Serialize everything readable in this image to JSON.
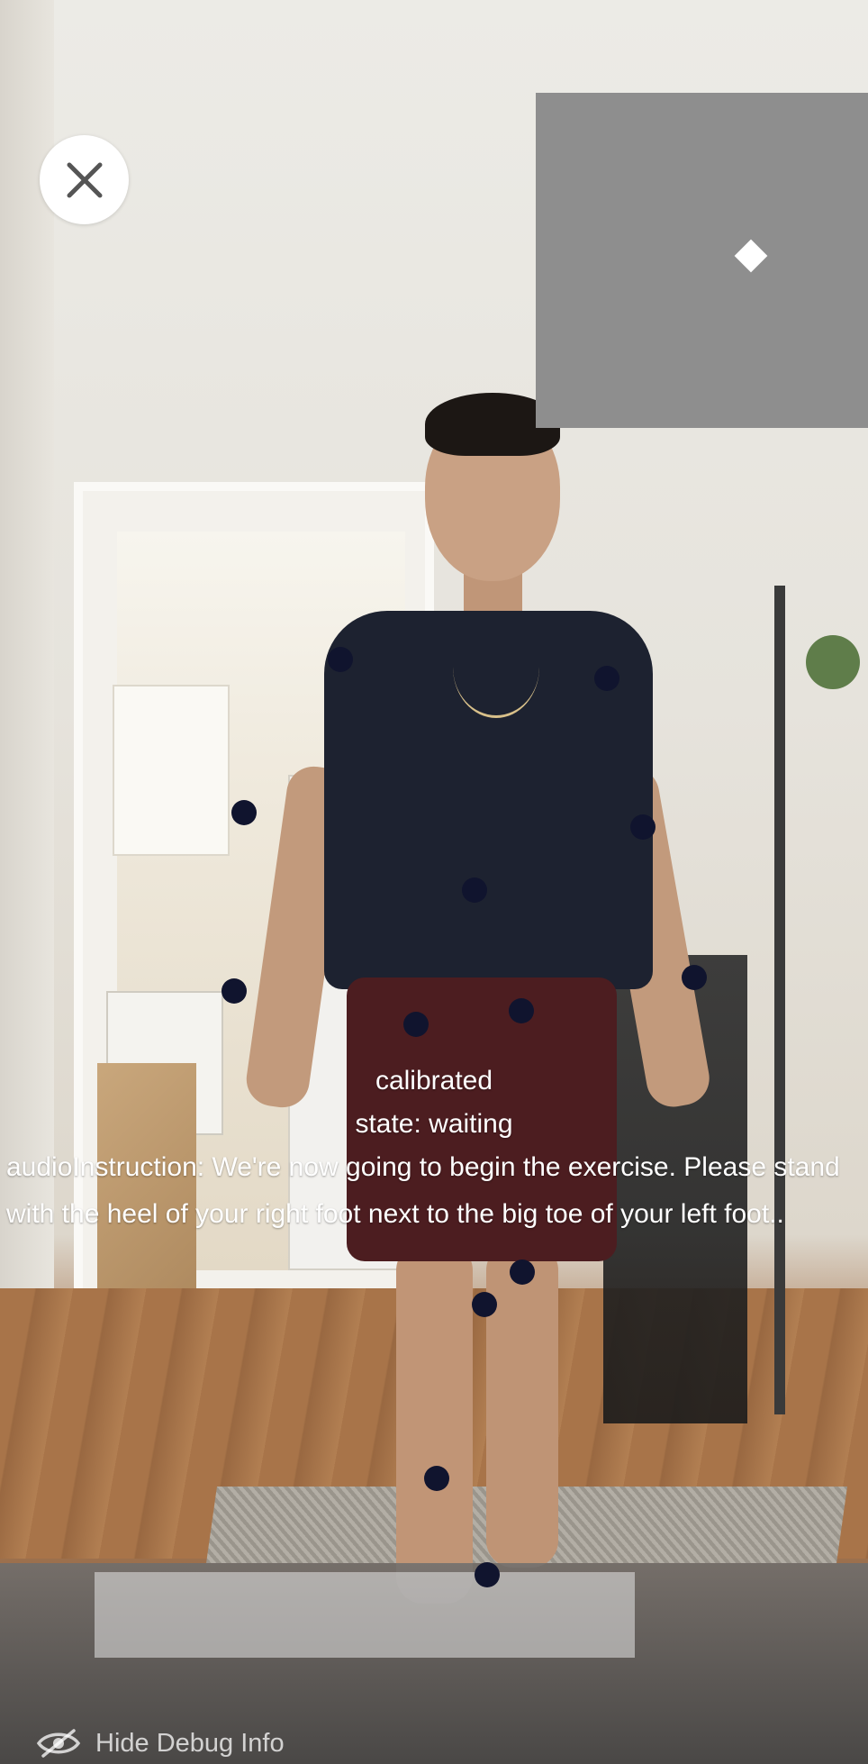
{
  "overlay": {
    "close_icon": "close-icon",
    "minimap_marker_icon": "diamond-marker"
  },
  "debug": {
    "calibrated": "calibrated",
    "state": "state: waiting",
    "audio_instruction": "audioInstruction: We're now going to begin the exercise. Please stand with the heel of your right foot next to the big toe of your left foot.."
  },
  "footer": {
    "hide_debug_label": "Hide Debug Info",
    "hide_debug_icon": "eye-slash-icon"
  },
  "pose": {
    "joint_color": "#10142e",
    "joint_count": 15
  }
}
